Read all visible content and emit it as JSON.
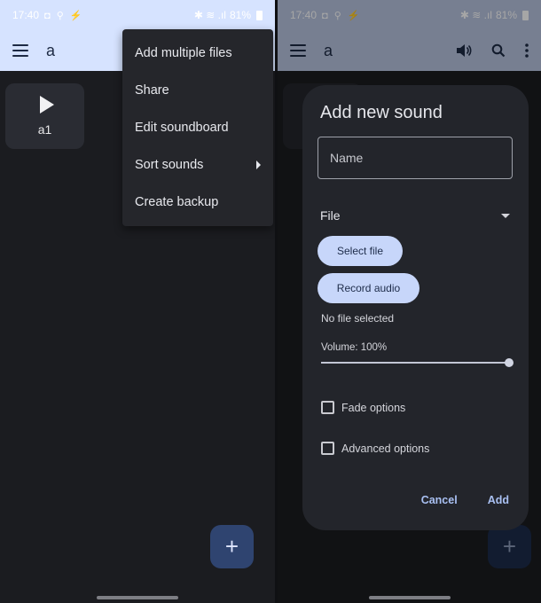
{
  "status_bar": {
    "time": "17:40",
    "notif_icons": "◘ ⚲ ⚡",
    "right_icons": "✱ ≋ .ıl",
    "battery": "81%"
  },
  "app": {
    "title": "a"
  },
  "sound_tile": {
    "label": "a1"
  },
  "overflow_menu": {
    "items": [
      {
        "label": "Add multiple files",
        "has_submenu": false
      },
      {
        "label": "Share",
        "has_submenu": false
      },
      {
        "label": "Edit soundboard",
        "has_submenu": false
      },
      {
        "label": "Sort sounds",
        "has_submenu": true
      },
      {
        "label": "Create backup",
        "has_submenu": false
      }
    ]
  },
  "fab": {
    "label": "+"
  },
  "dialog": {
    "title": "Add new sound",
    "name_placeholder": "Name",
    "file_label": "File",
    "select_file": "Select file",
    "record_audio": "Record audio",
    "no_file": "No file selected",
    "volume_label": "Volume: 100%",
    "volume_value": 1.0,
    "fade_options": "Fade options",
    "advanced_options": "Advanced options",
    "cancel": "Cancel",
    "add": "Add"
  },
  "colors": {
    "appbar": "#d6e3ff",
    "background": "#1b1c20",
    "fab": "#2f4470",
    "accent_button": "#c7d6fa",
    "text_button": "#a9c0f2"
  }
}
